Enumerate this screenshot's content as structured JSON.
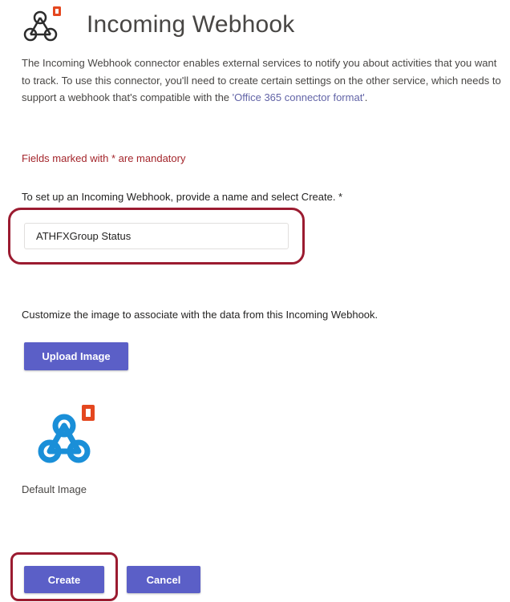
{
  "header": {
    "icon": "webhook-office-icon",
    "title": "Incoming Webhook"
  },
  "description": {
    "text": "The Incoming Webhook connector enables external services to notify you about activities that you want to track. To use this connector, you'll need to create certain settings on the other service, which needs to support a webhook that's compatible with the ",
    "link_text": "'Office 365 connector format'",
    "suffix": "."
  },
  "form": {
    "mandatory_note": "Fields marked with * are mandatory",
    "name_label": "To set up an Incoming Webhook, provide a name and select Create. *",
    "name_value": "ATHFXGroup Status",
    "image_label": "Customize the image to associate with the data from this Incoming Webhook.",
    "upload_button": "Upload Image",
    "default_image_icon": "webhook-office-icon",
    "default_image_label": "Default Image"
  },
  "actions": {
    "create": "Create",
    "cancel": "Cancel"
  },
  "colors": {
    "accent": "#5b5fc7",
    "highlight": "#9b1b30",
    "error_text": "#a4262c",
    "webhook_blue": "#1a8fd8",
    "office_orange": "#e4471f"
  }
}
